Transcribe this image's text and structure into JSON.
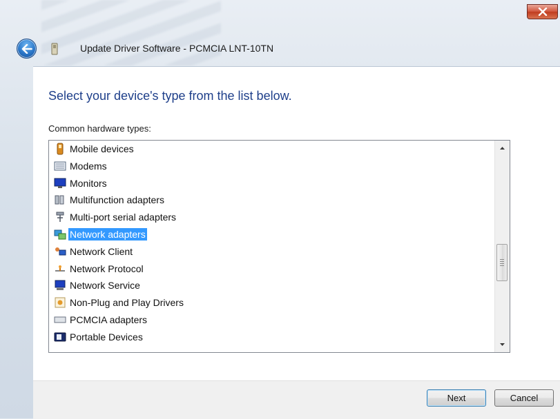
{
  "window": {
    "title": "Update Driver Software - PCMCIA LNT-10TN",
    "close_label": "X"
  },
  "main": {
    "heading": "Select your device's type from the list below.",
    "list_label": "Common hardware types:",
    "items": [
      {
        "label": "Mobile devices",
        "icon": "mobile-device-icon"
      },
      {
        "label": "Modems",
        "icon": "modem-icon"
      },
      {
        "label": "Monitors",
        "icon": "monitor-icon"
      },
      {
        "label": "Multifunction adapters",
        "icon": "multifunction-adapter-icon"
      },
      {
        "label": "Multi-port serial adapters",
        "icon": "serial-port-icon"
      },
      {
        "label": "Network adapters",
        "icon": "network-adapter-icon",
        "selected": true
      },
      {
        "label": "Network Client",
        "icon": "network-client-icon"
      },
      {
        "label": "Network Protocol",
        "icon": "network-protocol-icon"
      },
      {
        "label": "Network Service",
        "icon": "network-service-icon"
      },
      {
        "label": "Non-Plug and Play Drivers",
        "icon": "non-pnp-driver-icon"
      },
      {
        "label": "PCMCIA adapters",
        "icon": "pcmcia-adapter-icon"
      },
      {
        "label": "Portable Devices",
        "icon": "portable-device-icon"
      }
    ],
    "scroll_position": 0.55
  },
  "footer": {
    "next_label": "Next",
    "cancel_label": "Cancel"
  },
  "colors": {
    "selection": "#3399ff",
    "heading": "#1e3f8a"
  }
}
